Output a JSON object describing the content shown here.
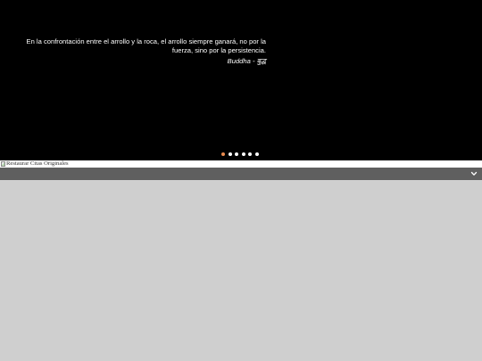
{
  "slider": {
    "quote": "En la confrontación entre el arrollo y la roca, el arrollo siempre ganará, no por la fuerza, sino por la persistencia.",
    "author": "Buddha - बुद्ध",
    "dots_total": 6,
    "active_dot": 1
  },
  "restore_image": {
    "alt": "Restaurar Citas Originales"
  },
  "colors": {
    "slider_bg": "#000000",
    "active_dot": "#e98b4f",
    "bar_bg": "#5f5f5f",
    "page_bg": "#cfcfcf"
  },
  "icons": {
    "toggle": "chevron-down-icon",
    "restore": "broken-image-icon"
  }
}
